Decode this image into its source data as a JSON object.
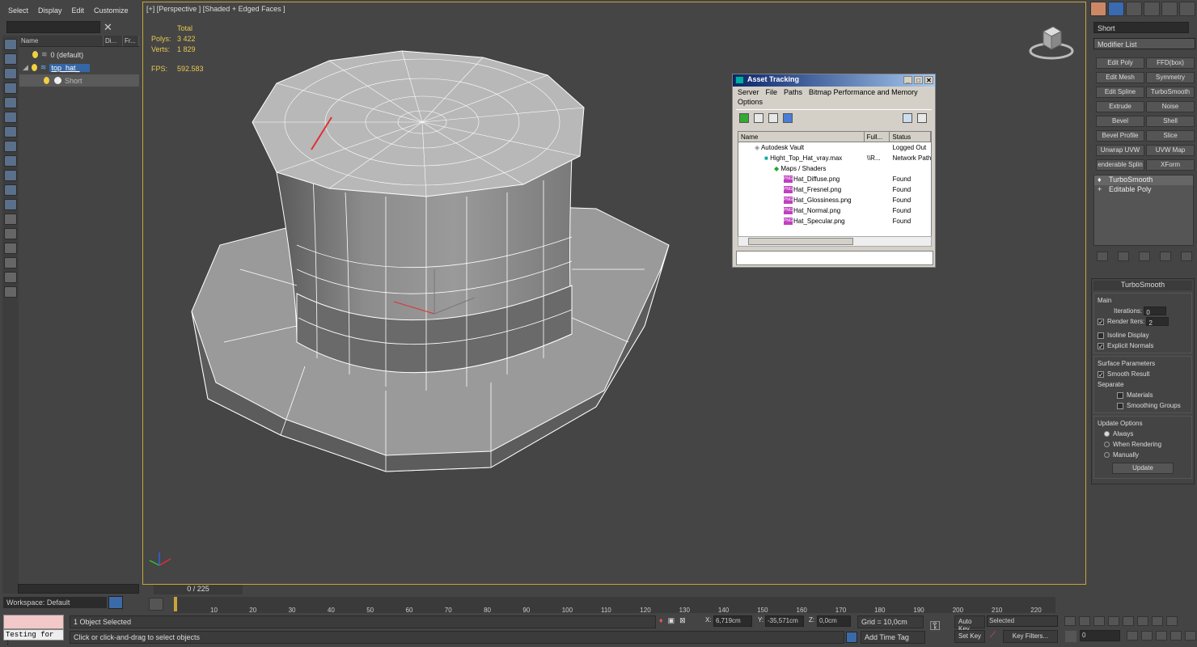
{
  "menu": {
    "items": [
      "Select",
      "Display",
      "Edit",
      "Customize"
    ]
  },
  "scene_explorer": {
    "columns": [
      "Name",
      "Di...",
      "Fr..."
    ],
    "rows": [
      {
        "label": "0 (default)"
      },
      {
        "label": "top_hat_"
      },
      {
        "label": "Short"
      }
    ],
    "workspace": "Workspace: Default"
  },
  "viewport": {
    "label": "[+] [Perspective ] [Shaded + Edged Faces ]",
    "stats": {
      "total_label": "Total",
      "polys_label": "Polys:",
      "polys_value": "3 422",
      "verts_label": "Verts:",
      "verts_value": "1 829",
      "fps_label": "FPS:",
      "fps_value": "592.583"
    }
  },
  "asset_tracking": {
    "title": "Asset Tracking",
    "menu": [
      "Server",
      "File",
      "Paths",
      "Bitmap Performance and Memory",
      "Options"
    ],
    "columns": [
      "Name",
      "Full...",
      "Status"
    ],
    "rows": [
      {
        "name": "Autodesk Vault",
        "full": "",
        "status": "Logged Out"
      },
      {
        "name": "Hight_Top_Hat_vray.max",
        "full": "\\\\R...",
        "status": "Network Path"
      },
      {
        "name": "Maps / Shaders",
        "full": "",
        "status": ""
      },
      {
        "name": "Hat_Diffuse.png",
        "full": "",
        "status": "Found"
      },
      {
        "name": "Hat_Fresnel.png",
        "full": "",
        "status": "Found"
      },
      {
        "name": "Hat_Glossiness.png",
        "full": "",
        "status": "Found"
      },
      {
        "name": "Hat_Normal.png",
        "full": "",
        "status": "Found"
      },
      {
        "name": "Hat_Specular.png",
        "full": "",
        "status": "Found"
      }
    ],
    "png_badge": "PNG"
  },
  "command_panel": {
    "object_name": "Short",
    "modifier_list": "Modifier List",
    "modifier_buttons": [
      "Edit Poly",
      "FFD(box)",
      "Edit Mesh",
      "Symmetry",
      "Edit Spline",
      "TurboSmooth",
      "Extrude",
      "Noise",
      "Bevel",
      "Shell",
      "Bevel Profile",
      "Slice",
      "Unwrap UVW",
      "UVW Map",
      "enderable Splin",
      "XForm"
    ],
    "stack": [
      "TurboSmooth",
      "Editable Poly"
    ],
    "turbosmooth": {
      "title": "TurboSmooth",
      "main": "Main",
      "iterations_label": "Iterations:",
      "iterations": "0",
      "render_iters_label": "Render Iters:",
      "render_iters": "2",
      "isoline": "Isoline Display",
      "explicit": "Explicit Normals",
      "surface": "Surface Parameters",
      "smooth_result": "Smooth Result",
      "separate": "Separate",
      "materials": "Materials",
      "smoothing_groups": "Smoothing Groups",
      "update_options": "Update Options",
      "always": "Always",
      "when_rendering": "When Rendering",
      "manually": "Manually",
      "update": "Update"
    }
  },
  "timeline": {
    "slider": "0 / 225",
    "ticks": [
      "10",
      "20",
      "30",
      "40",
      "50",
      "60",
      "70",
      "80",
      "90",
      "100",
      "110",
      "120",
      "130",
      "140",
      "150",
      "160",
      "170",
      "180",
      "190",
      "200",
      "210",
      "220"
    ]
  },
  "status": {
    "listener": "Testing for :",
    "selected": "1 Object Selected",
    "prompt": "Click or click-and-drag to select objects",
    "x_label": "X:",
    "x": "6,719cm",
    "y_label": "Y:",
    "y": "-35,571cm",
    "z_label": "Z:",
    "z": "0,0cm",
    "grid": "Grid = 10,0cm",
    "add_time_tag": "Add Time Tag",
    "auto_key": "Auto Key",
    "set_key": "Set Key",
    "selected_dropdown": "Selected",
    "key_filters": "Key Filters...",
    "frame": "0"
  }
}
